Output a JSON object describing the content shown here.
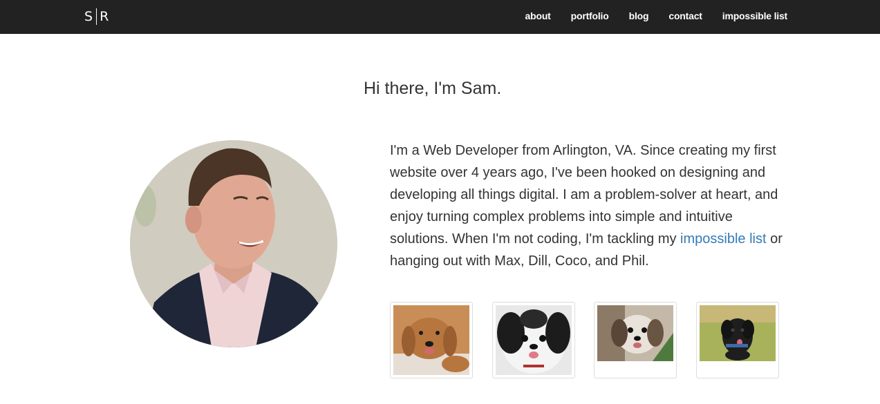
{
  "nav": {
    "brand_left": "S",
    "brand_right": "R",
    "links": [
      "about",
      "portfolio",
      "blog",
      "contact",
      "impossible list"
    ]
  },
  "hero": {
    "greeting": "Hi there, I'm Sam.",
    "bio_before_link": "I'm a Web Developer from Arlington, VA. Since creating my first website over 4 years ago, I've been hooked on designing and developing all things digital. I am a problem-solver at heart, and enjoy turning complex problems into simple and intuitive solutions. When I'm not coding, I'm tackling my ",
    "bio_link": "impossible list",
    "bio_after_link": " or hanging out with Max, Dill, Coco, and Phil."
  },
  "colors": {
    "navbar": "#222222",
    "link": "#337ab7",
    "text": "#333333"
  },
  "images": {
    "avatar": "profile-photo",
    "dogs": [
      "golden-retriever-photo",
      "black-white-dog-photo",
      "shih-tzu-photo",
      "black-dog-grass-photo"
    ]
  }
}
